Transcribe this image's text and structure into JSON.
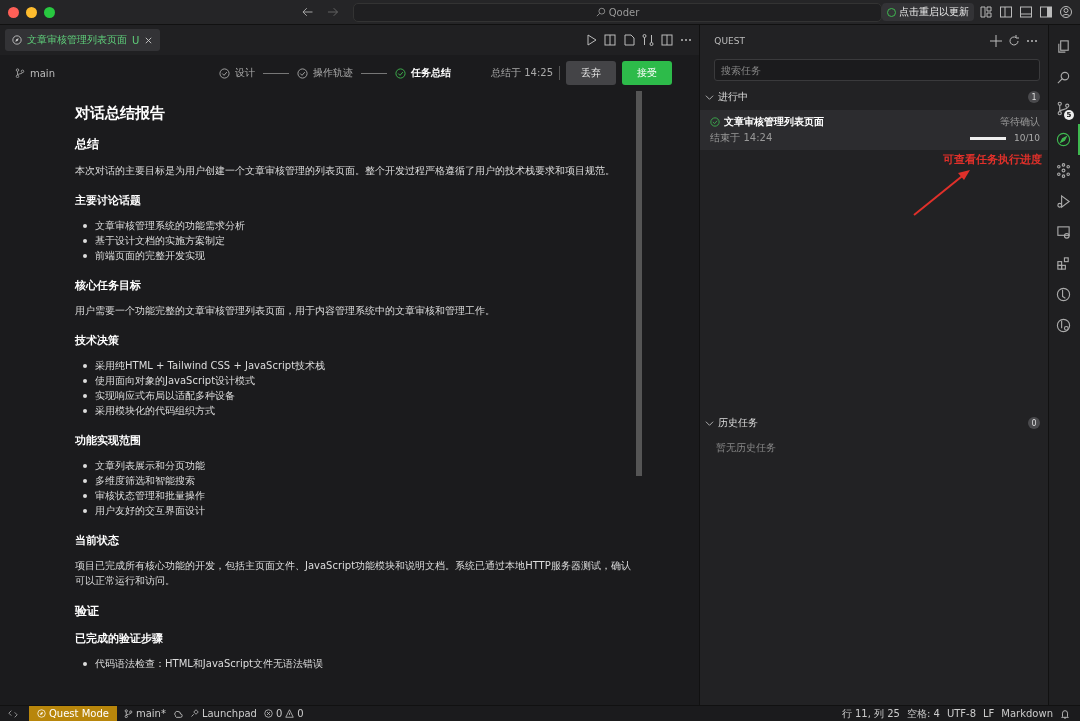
{
  "window": {
    "search": "Qoder",
    "update_button": "点击重启以更新"
  },
  "editor_tab": {
    "label": "文章审核管理列表页面",
    "badge": "U"
  },
  "toolbar": {
    "branch": "main",
    "steps": [
      {
        "label": "设计",
        "selected": false
      },
      {
        "label": "操作轨迹",
        "selected": false
      },
      {
        "label": "任务总结",
        "selected": true
      }
    ],
    "summary_time": "总结于 14:25",
    "discard_button": "丢弃",
    "accept_button": "接受"
  },
  "document": [
    {
      "kind": "h1",
      "text": "对话总结报告"
    },
    {
      "kind": "h2",
      "text": "总结"
    },
    {
      "kind": "p",
      "text": "本次对话的主要目标是为用户创建一个文章审核管理的列表页面。整个开发过程严格遵循了用户的技术栈要求和项目规范。"
    },
    {
      "kind": "h3",
      "text": "主要讨论话题"
    },
    {
      "kind": "ul",
      "items": [
        "文章审核管理系统的功能需求分析",
        "基于设计文档的实施方案制定",
        "前端页面的完整开发实现"
      ]
    },
    {
      "kind": "h3",
      "text": "核心任务目标"
    },
    {
      "kind": "p",
      "text": "用户需要一个功能完整的文章审核管理列表页面，用于内容管理系统中的文章审核和管理工作。"
    },
    {
      "kind": "h3",
      "text": "技术决策"
    },
    {
      "kind": "ul",
      "items": [
        "采用纯HTML + Tailwind CSS + JavaScript技术栈",
        "使用面向对象的JavaScript设计模式",
        "实现响应式布局以适配多种设备",
        "采用模块化的代码组织方式"
      ]
    },
    {
      "kind": "h3",
      "text": "功能实现范围"
    },
    {
      "kind": "ul",
      "items": [
        "文章列表展示和分页功能",
        "多维度筛选和智能搜索",
        "审核状态管理和批量操作",
        "用户友好的交互界面设计"
      ]
    },
    {
      "kind": "h3",
      "text": "当前状态"
    },
    {
      "kind": "p",
      "text": "项目已完成所有核心功能的开发，包括主页面文件、JavaScript功能模块和说明文档。系统已通过本地HTTP服务器测试，确认可以正常运行和访问。"
    },
    {
      "kind": "h2",
      "text": "验证"
    },
    {
      "kind": "h3",
      "text": "已完成的验证步骤"
    },
    {
      "kind": "ul",
      "items": [
        "代码语法检查：HTML和JavaScript文件无语法错误"
      ]
    }
  ],
  "quest": {
    "title": "QUEST",
    "search": {
      "placeholder": "搜索任务"
    },
    "sections": [
      {
        "title": "进行中",
        "count": "1",
        "expanded": true,
        "tasks": [
          {
            "title": "文章审核管理列表页面",
            "status": "等待确认",
            "ended": "结束于 14:24",
            "progress": "10/10",
            "level": 1.0
          }
        ]
      },
      {
        "title": "历史任务",
        "count": "0",
        "expanded": true,
        "empty_text": "暂无历史任务"
      }
    ]
  },
  "annotation": "可查看任务执行进度",
  "activity_bar": [
    {
      "kind": "files",
      "selected": false
    },
    {
      "kind": "search",
      "selected": false
    },
    {
      "kind": "branch",
      "selected": false,
      "badge": "5"
    },
    {
      "kind": "quest",
      "selected": true
    },
    {
      "kind": "nodes",
      "selected": false
    },
    {
      "kind": "run",
      "selected": false
    },
    {
      "kind": "remote",
      "selected": false
    },
    {
      "kind": "extensions",
      "selected": false
    },
    {
      "kind": "timeline",
      "selected": false
    },
    {
      "kind": "history",
      "selected": false
    }
  ],
  "status_bar": {
    "mode": "Quest Mode",
    "branch": "main*",
    "launchpad": "Launchpad",
    "errors": "0",
    "warnings": "0",
    "right": [
      "行 11, 列 25",
      "空格: 4",
      "UTF-8",
      "LF",
      "Markdown"
    ]
  }
}
